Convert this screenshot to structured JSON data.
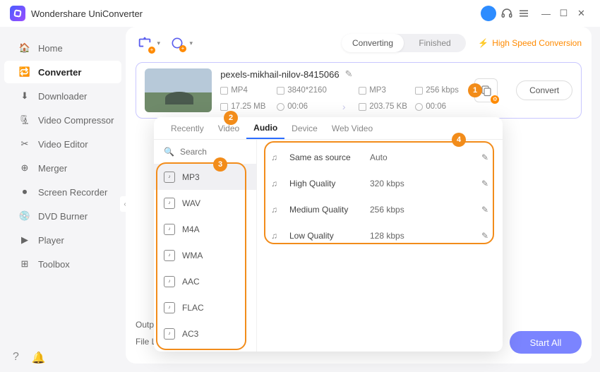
{
  "app": {
    "title": "Wondershare UniConverter"
  },
  "nav": {
    "items": [
      {
        "label": "Home"
      },
      {
        "label": "Converter"
      },
      {
        "label": "Downloader"
      },
      {
        "label": "Video Compressor"
      },
      {
        "label": "Video Editor"
      },
      {
        "label": "Merger"
      },
      {
        "label": "Screen Recorder"
      },
      {
        "label": "DVD Burner"
      },
      {
        "label": "Player"
      },
      {
        "label": "Toolbox"
      }
    ],
    "active_index": 1
  },
  "toolbar": {
    "segments": [
      "Converting",
      "Finished"
    ],
    "active_segment": 0,
    "high_speed_label": "High Speed Conversion"
  },
  "file": {
    "name": "pexels-mikhail-nilov-8415066",
    "src": {
      "container": "MP4",
      "resolution": "3840*2160",
      "size": "17.25 MB",
      "duration": "00:06"
    },
    "dst": {
      "container": "MP3",
      "bitrate": "256 kbps",
      "size": "203.75 KB",
      "duration": "00:06"
    },
    "convert_label": "Convert"
  },
  "popup": {
    "tabs": [
      "Recently",
      "Video",
      "Audio",
      "Device",
      "Web Video"
    ],
    "active_tab": 2,
    "search_placeholder": "Search",
    "formats": [
      "MP3",
      "WAV",
      "M4A",
      "WMA",
      "AAC",
      "FLAC",
      "AC3"
    ],
    "selected_format": 0,
    "qualities": [
      {
        "name": "Same as source",
        "rate": "Auto"
      },
      {
        "name": "High Quality",
        "rate": "320 kbps"
      },
      {
        "name": "Medium Quality",
        "rate": "256 kbps"
      },
      {
        "name": "Low Quality",
        "rate": "128 kbps"
      }
    ]
  },
  "bottom": {
    "output_label": "Output",
    "fileloc_label": "File Loc",
    "start_all": "Start All"
  },
  "callouts": {
    "c1": "1",
    "c2": "2",
    "c3": "3",
    "c4": "4"
  }
}
